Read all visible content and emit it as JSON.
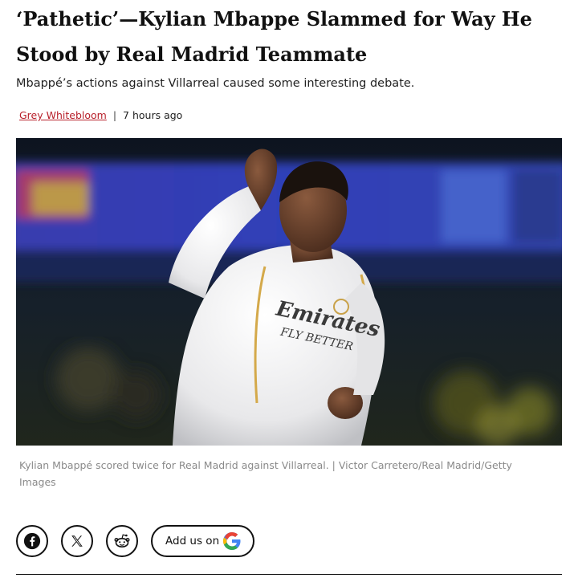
{
  "article": {
    "headline": "‘Pathetic’—Kylian Mbappe Slammed for Way He Stood by Real Madrid Teammate",
    "subhead": "Mbappé’s actions against Villarreal caused some interesting debate.",
    "byline": {
      "author": "Grey Whitebloom",
      "separator": "|",
      "time": "7 hours ago"
    },
    "image": {
      "shirt_sponsor_line1": "Emirates",
      "shirt_sponsor_line2": "FLY BETTER"
    },
    "caption": "Kylian Mbappé scored twice for Real Madrid against Villarreal. | Victor Carretero/Real Madrid/Getty Images"
  },
  "share": {
    "facebook_icon": "facebook-icon",
    "x_icon": "x-icon",
    "reddit_icon": "reddit-icon",
    "google_button_label": "Add us on",
    "google_icon": "google-g-icon"
  },
  "colors": {
    "author_link": "#b8202b",
    "caption_text": "#8a8a8a",
    "google_blue": "#4285F4",
    "google_red": "#EA4335",
    "google_yellow": "#FBBC05",
    "google_green": "#34A853"
  }
}
